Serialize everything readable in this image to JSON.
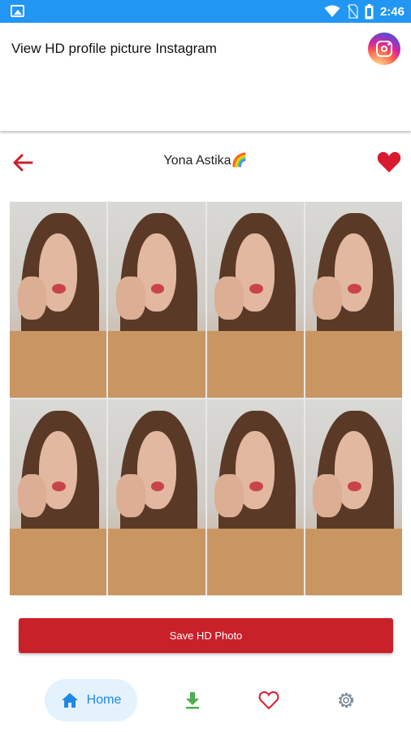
{
  "status_bar": {
    "time": "2:46"
  },
  "app_bar": {
    "title": "View HD profile picture Instagram"
  },
  "profile": {
    "name": "Yona Astika🌈"
  },
  "photos": [
    "photo-1",
    "photo-2",
    "photo-3",
    "photo-4",
    "photo-5",
    "photo-6",
    "photo-7",
    "photo-8"
  ],
  "actions": {
    "save_label": "Save HD Photo"
  },
  "bottom_nav": {
    "items": [
      {
        "label": "Home",
        "icon": "home-icon"
      },
      {
        "label": "",
        "icon": "download-icon"
      },
      {
        "label": "",
        "icon": "heart-outline-icon"
      },
      {
        "label": "",
        "icon": "settings-icon"
      }
    ]
  },
  "colors": {
    "status_bar": "#2196f3",
    "accent_red": "#c9212a",
    "nav_active_bg": "#e3f2fd",
    "nav_active": "#1e88e5",
    "download_green": "#4caf50"
  }
}
